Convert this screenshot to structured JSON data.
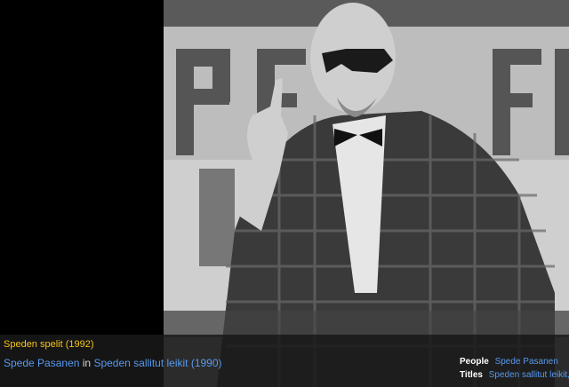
{
  "section_title": "Speden spelit (1992)",
  "caption": {
    "person": "Spede Pasanen",
    "connector": "in",
    "title": "Speden sallitut leikit (1990)"
  },
  "meta": {
    "people_label": "People",
    "people_value": "Spede Pasanen",
    "titles_label": "Titles",
    "titles_value": "Speden sallitut leikit,"
  },
  "colors": {
    "section_title": "#f5c518",
    "link": "#5799ef",
    "caption_text": "#d6d6d6",
    "background": "#000000"
  }
}
